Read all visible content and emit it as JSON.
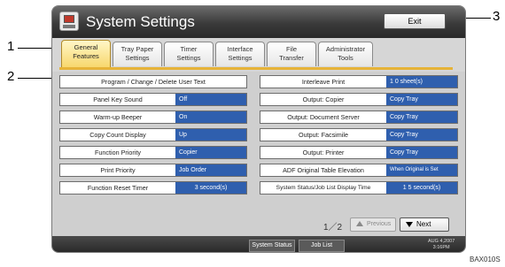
{
  "callouts": {
    "c1": "1",
    "c2": "2",
    "c3": "3"
  },
  "window": {
    "title": "System Settings",
    "exit_label": "Exit"
  },
  "tabs": [
    {
      "line1": "General",
      "line2": "Features"
    },
    {
      "line1": "Tray Paper",
      "line2": "Settings"
    },
    {
      "line1": "Timer",
      "line2": "Settings"
    },
    {
      "line1": "Interface",
      "line2": "Settings"
    },
    {
      "line1": "File",
      "line2": "Transfer"
    },
    {
      "line1": "Administrator",
      "line2": "Tools"
    }
  ],
  "left_settings": [
    {
      "label": "Program / Change / Delete User Text",
      "value": ""
    },
    {
      "label": "Panel Key Sound",
      "value": "Off"
    },
    {
      "label": "Warm-up Beeper",
      "value": "On"
    },
    {
      "label": "Copy Count Display",
      "value": "Up"
    },
    {
      "label": "Function Priority",
      "value": "Copier"
    },
    {
      "label": "Print Priority",
      "value": "Job Order"
    },
    {
      "label": "Function Reset Timer",
      "value": "3 second(s)"
    }
  ],
  "right_settings": [
    {
      "label": "Interleave Print",
      "value": "1 0 sheet(s)"
    },
    {
      "label": "Output: Copier",
      "value": "Copy Tray"
    },
    {
      "label": "Output: Document Server",
      "value": "Copy Tray"
    },
    {
      "label": "Output: Facsimile",
      "value": "Copy Tray"
    },
    {
      "label": "Output: Printer",
      "value": "Copy Tray"
    },
    {
      "label": "ADF Original Table Elevation",
      "value": "When Original is Set"
    },
    {
      "label": "System Status/Job List Display Time",
      "value": "1 5 second(s)"
    }
  ],
  "pager": {
    "page": "1／2",
    "previous": "Previous",
    "next": "Next"
  },
  "statusbar": {
    "system_status": "System Status",
    "job_list": "Job List",
    "date": "AUG   4,2007",
    "time": "3:16PM"
  },
  "image_code": "BAX010S",
  "colors": {
    "accent_tab": "#f7d66a",
    "value_bg": "#2f5fae",
    "titlebar": "#3a3a3a"
  }
}
